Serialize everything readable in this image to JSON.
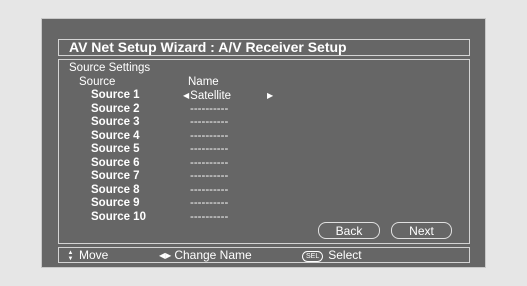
{
  "window": {
    "title": "AV Net Setup Wizard : A/V Receiver Setup"
  },
  "panel": {
    "section_title": "Source Settings",
    "columns": {
      "source": "Source",
      "name": "Name"
    },
    "rows": [
      {
        "source": "Source 1",
        "name": "Satellite",
        "selected": true
      },
      {
        "source": "Source 2",
        "name": "----------"
      },
      {
        "source": "Source 3",
        "name": "----------"
      },
      {
        "source": "Source 4",
        "name": "----------"
      },
      {
        "source": "Source 5",
        "name": "----------"
      },
      {
        "source": "Source 6",
        "name": "----------"
      },
      {
        "source": "Source 7",
        "name": "----------"
      },
      {
        "source": "Source 8",
        "name": "----------"
      },
      {
        "source": "Source 9",
        "name": "----------"
      },
      {
        "source": "Source 10",
        "name": "----------"
      }
    ],
    "buttons": {
      "back": "Back",
      "next": "Next"
    }
  },
  "hints": {
    "move": "Move",
    "change_name": "Change Name",
    "sel_key": "SEL",
    "select": "Select"
  },
  "icons": {
    "up_down": "up-down-arrows-icon",
    "left_right": "left-right-arrows-icon",
    "sel": "sel-key-icon"
  },
  "colors": {
    "background": "#666666",
    "text": "#ffffff",
    "border": "#d4d4d4",
    "page": "#e6e6e6"
  }
}
